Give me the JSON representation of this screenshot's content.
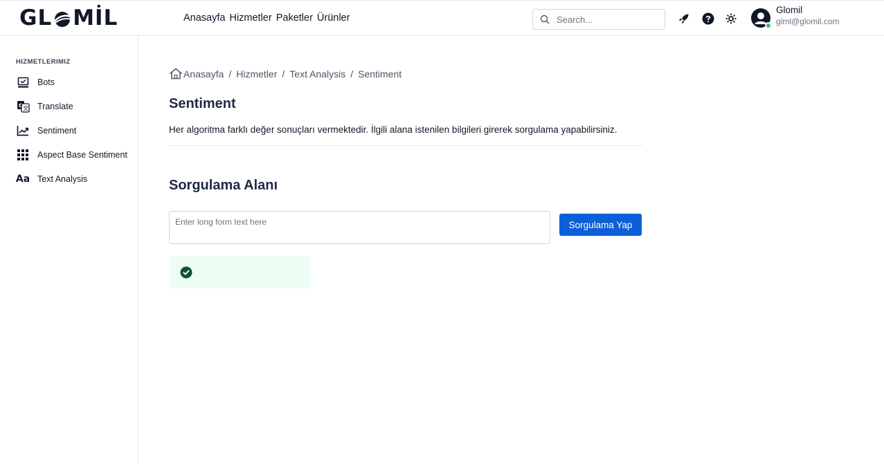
{
  "header": {
    "logo": {
      "left": "GL",
      "right": "MİL"
    },
    "nav": [
      {
        "label": "Anasayfa"
      },
      {
        "label": "Hizmetler"
      },
      {
        "label": "Paketler"
      },
      {
        "label": "Ürünler"
      }
    ],
    "search": {
      "placeholder": "Search...",
      "icon": "search-icon"
    },
    "icons": [
      "rocket-icon",
      "help-icon",
      "settings-icon"
    ],
    "user": {
      "name": "Glomil",
      "email": "glml@glomil.com",
      "status_color": "#22c55e"
    }
  },
  "sidebar": {
    "title": "HIZMETLERIMIZ",
    "items": [
      {
        "label": "Bots",
        "icon": "monitor-icon"
      },
      {
        "label": "Translate",
        "icon": "translate-icon"
      },
      {
        "label": "Sentiment",
        "icon": "trend-chart-icon"
      },
      {
        "label": "Aspect Base Sentiment",
        "icon": "grid-dots-icon"
      },
      {
        "label": "Text Analysis",
        "icon": "text-aa-icon",
        "glyph": "Aa"
      }
    ]
  },
  "main": {
    "breadcrumb": [
      "Anasayfa",
      "Hizmetler",
      "Text Analysis",
      "Sentiment"
    ],
    "breadcrumb_separator": "/",
    "title": "Sentiment",
    "description": "Her algoritma farklı değer sonuçları vermektedir. İlgili alana istenilen bilgileri girerek sorgulama yapabilirsiniz.",
    "section_title": "Sorgulama Alanı",
    "input": {
      "placeholder": "Enter long form text here",
      "value": ""
    },
    "button_label": "Sorgulama Yap",
    "result": {
      "icon": "check-circle-icon",
      "text": ""
    }
  },
  "colors": {
    "primary": "#0b5ed7",
    "heading": "#1f2a44",
    "success_bg": "#ecfdf3",
    "success_icon": "#0f5132"
  }
}
